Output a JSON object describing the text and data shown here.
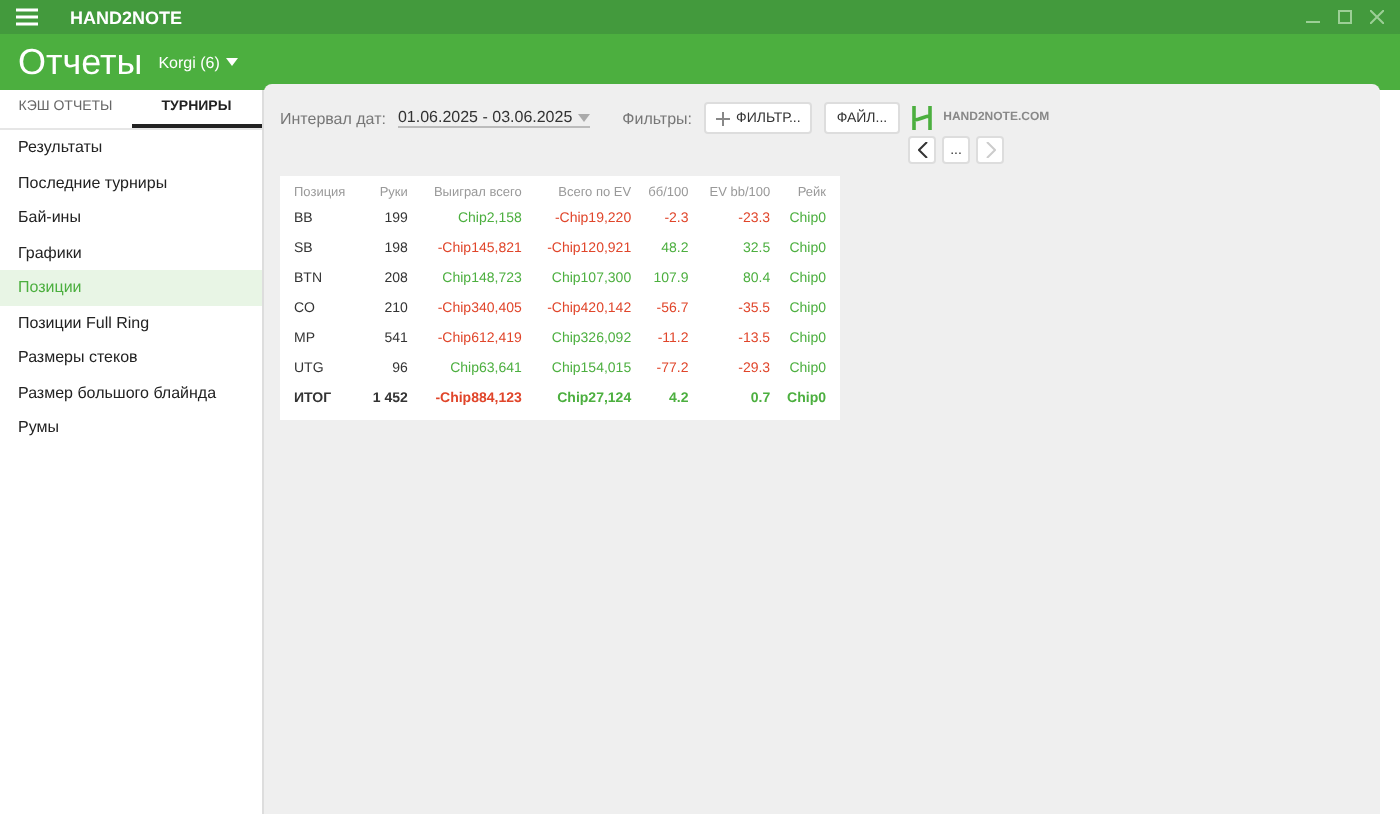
{
  "app": {
    "name": "HAND2NOTE"
  },
  "header": {
    "title": "Отчеты",
    "player": "Korgi (6)"
  },
  "tabs": [
    {
      "label": "КЭШ ОТЧЕТЫ",
      "selected": false
    },
    {
      "label": "ТУРНИРЫ",
      "selected": true
    }
  ],
  "sidebar": {
    "items": [
      {
        "label": "Результаты",
        "selected": false
      },
      {
        "label": "Последние турниры",
        "selected": false
      },
      {
        "label": "Бай-ины",
        "selected": false
      },
      {
        "label": "Графики",
        "selected": false
      },
      {
        "label": "Позиции",
        "selected": true
      },
      {
        "label": "Позиции Full Ring",
        "selected": false
      },
      {
        "label": "Размеры стеков",
        "selected": false
      },
      {
        "label": "Размер большого блайнда",
        "selected": false
      },
      {
        "label": "Румы",
        "selected": false
      }
    ]
  },
  "toolbar": {
    "date_label": "Интервал дат:",
    "date_value": "01.06.2025 - 03.06.2025",
    "filters_label": "Фильтры:",
    "filter_button": "ФИЛЬТР...",
    "file_button": "ФАЙЛ...",
    "site": "HAND2NOTE.COM",
    "page_button": "..."
  },
  "table": {
    "columns": [
      "Позиция",
      "Руки",
      "Выиграл всего",
      "Всего по EV",
      "бб/100",
      "EV bb/100",
      "Рейк"
    ],
    "rows": [
      {
        "total": false,
        "cells": [
          {
            "text": "BB"
          },
          {
            "text": "199"
          },
          {
            "text": "Chip2,158",
            "color": "#4caf3f"
          },
          {
            "text": "-Chip19,220",
            "color": "#e0452a"
          },
          {
            "text": "-2.3",
            "color": "#e0452a"
          },
          {
            "text": "-23.3",
            "color": "#e0452a"
          },
          {
            "text": "Chip0",
            "color": "#4caf3f"
          }
        ]
      },
      {
        "total": false,
        "cells": [
          {
            "text": "SB"
          },
          {
            "text": "198"
          },
          {
            "text": "-Chip145,821",
            "color": "#e0452a"
          },
          {
            "text": "-Chip120,921",
            "color": "#e0452a"
          },
          {
            "text": "48.2",
            "color": "#4caf3f"
          },
          {
            "text": "32.5",
            "color": "#4caf3f"
          },
          {
            "text": "Chip0",
            "color": "#4caf3f"
          }
        ]
      },
      {
        "total": false,
        "cells": [
          {
            "text": "BTN"
          },
          {
            "text": "208"
          },
          {
            "text": "Chip148,723",
            "color": "#4caf3f"
          },
          {
            "text": "Chip107,300",
            "color": "#4caf3f"
          },
          {
            "text": "107.9",
            "color": "#4caf3f"
          },
          {
            "text": "80.4",
            "color": "#4caf3f"
          },
          {
            "text": "Chip0",
            "color": "#4caf3f"
          }
        ]
      },
      {
        "total": false,
        "cells": [
          {
            "text": "CO"
          },
          {
            "text": "210"
          },
          {
            "text": "-Chip340,405",
            "color": "#e0452a"
          },
          {
            "text": "-Chip420,142",
            "color": "#e0452a"
          },
          {
            "text": "-56.7",
            "color": "#e0452a"
          },
          {
            "text": "-35.5",
            "color": "#e0452a"
          },
          {
            "text": "Chip0",
            "color": "#4caf3f"
          }
        ]
      },
      {
        "total": false,
        "cells": [
          {
            "text": "MP"
          },
          {
            "text": "541"
          },
          {
            "text": "-Chip612,419",
            "color": "#e0452a"
          },
          {
            "text": "Chip326,092",
            "color": "#4caf3f"
          },
          {
            "text": "-11.2",
            "color": "#e0452a"
          },
          {
            "text": "-13.5",
            "color": "#e0452a"
          },
          {
            "text": "Chip0",
            "color": "#4caf3f"
          }
        ]
      },
      {
        "total": false,
        "cells": [
          {
            "text": "UTG"
          },
          {
            "text": "96"
          },
          {
            "text": "Chip63,641",
            "color": "#4caf3f"
          },
          {
            "text": "Chip154,015",
            "color": "#4caf3f"
          },
          {
            "text": "-77.2",
            "color": "#e0452a"
          },
          {
            "text": "-29.3",
            "color": "#e0452a"
          },
          {
            "text": "Chip0",
            "color": "#4caf3f"
          }
        ]
      },
      {
        "total": true,
        "cells": [
          {
            "text": "ИТОГ"
          },
          {
            "text": "1 452"
          },
          {
            "text": "-Chip884,123",
            "color": "#e0452a"
          },
          {
            "text": "Chip27,124",
            "color": "#4caf3f"
          },
          {
            "text": "4.2",
            "color": "#4caf3f"
          },
          {
            "text": "0.7",
            "color": "#4caf3f"
          },
          {
            "text": "Chip0",
            "color": "#4caf3f"
          }
        ]
      }
    ]
  }
}
